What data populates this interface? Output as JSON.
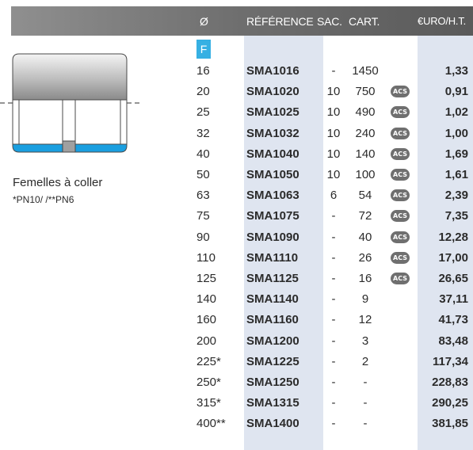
{
  "header": {
    "diameter": "Ø",
    "reference": "RÉFÉRENCE",
    "sac": "SAC.",
    "cart": "CART.",
    "price": "€URO/H.T."
  },
  "badge": "F",
  "caption": {
    "title": "Femelles à coller",
    "note": "*PN10/ /**PN6"
  },
  "acs_label": "ACS",
  "colors": {
    "header_bg": "#6e6e6e",
    "column_highlight": "#dfe5f0",
    "badge_blue": "#36b0e3",
    "fitting_blue": "#1a9fe0",
    "acs_gray": "#6f6f6f"
  },
  "rows": [
    {
      "dia": "16",
      "ref": "SMA1016",
      "sac": "-",
      "cart": "1450",
      "acs": false,
      "price": "1,33"
    },
    {
      "dia": "20",
      "ref": "SMA1020",
      "sac": "10",
      "cart": "750",
      "acs": true,
      "price": "0,91"
    },
    {
      "dia": "25",
      "ref": "SMA1025",
      "sac": "10",
      "cart": "490",
      "acs": true,
      "price": "1,02"
    },
    {
      "dia": "32",
      "ref": "SMA1032",
      "sac": "10",
      "cart": "240",
      "acs": true,
      "price": "1,00"
    },
    {
      "dia": "40",
      "ref": "SMA1040",
      "sac": "10",
      "cart": "140",
      "acs": true,
      "price": "1,69"
    },
    {
      "dia": "50",
      "ref": "SMA1050",
      "sac": "10",
      "cart": "100",
      "acs": true,
      "price": "1,61"
    },
    {
      "dia": "63",
      "ref": "SMA1063",
      "sac": "6",
      "cart": "54",
      "acs": true,
      "price": "2,39"
    },
    {
      "dia": "75",
      "ref": "SMA1075",
      "sac": "-",
      "cart": "72",
      "acs": true,
      "price": "7,35"
    },
    {
      "dia": "90",
      "ref": "SMA1090",
      "sac": "-",
      "cart": "40",
      "acs": true,
      "price": "12,28"
    },
    {
      "dia": "110",
      "ref": "SMA1110",
      "sac": "-",
      "cart": "26",
      "acs": true,
      "price": "17,00"
    },
    {
      "dia": "125",
      "ref": "SMA1125",
      "sac": "-",
      "cart": "16",
      "acs": true,
      "price": "26,65"
    },
    {
      "dia": "140",
      "ref": "SMA1140",
      "sac": "-",
      "cart": "9",
      "acs": false,
      "price": "37,11"
    },
    {
      "dia": "160",
      "ref": "SMA1160",
      "sac": "-",
      "cart": "12",
      "acs": false,
      "price": "41,73"
    },
    {
      "dia": "200",
      "ref": "SMA1200",
      "sac": "-",
      "cart": "3",
      "acs": false,
      "price": "83,48"
    },
    {
      "dia": "225*",
      "ref": "SMA1225",
      "sac": "-",
      "cart": "2",
      "acs": false,
      "price": "117,34"
    },
    {
      "dia": "250*",
      "ref": "SMA1250",
      "sac": "-",
      "cart": "-",
      "acs": false,
      "price": "228,83"
    },
    {
      "dia": "315*",
      "ref": "SMA1315",
      "sac": "-",
      "cart": "-",
      "acs": false,
      "price": "290,25"
    },
    {
      "dia": "400**",
      "ref": "SMA1400",
      "sac": "-",
      "cart": "-",
      "acs": false,
      "price": "381,85"
    }
  ]
}
